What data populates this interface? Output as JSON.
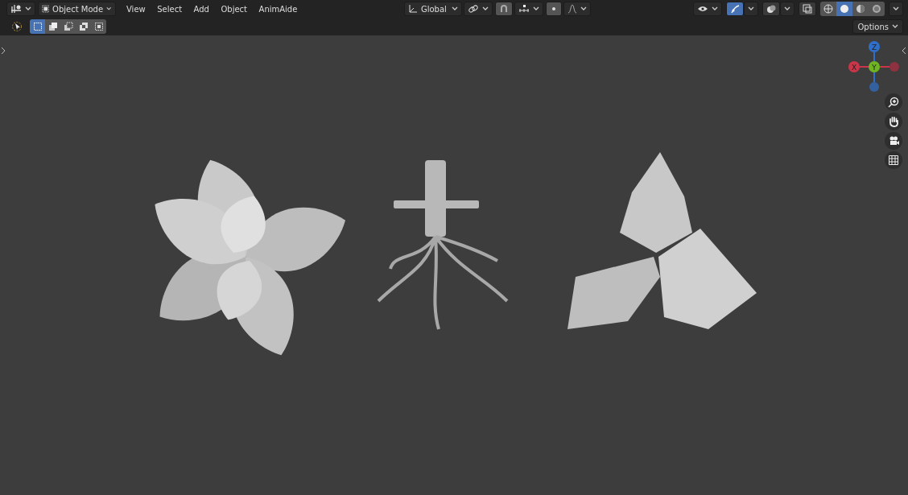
{
  "header": {
    "mode": {
      "value": "Object Mode"
    },
    "menus": [
      "View",
      "Select",
      "Add",
      "Object",
      "AnimAide"
    ],
    "orientation": {
      "value": "Global"
    },
    "viewport_toggles": [
      {
        "kind": "gizmos",
        "on": true
      },
      {
        "kind": "overlays",
        "on": false
      },
      {
        "kind": "xray",
        "on": false
      }
    ],
    "shading_modes": [
      {
        "kind": "wireframe",
        "selected": false
      },
      {
        "kind": "solid",
        "selected": true
      },
      {
        "kind": "material",
        "selected": false
      },
      {
        "kind": "rendered",
        "selected": false
      }
    ]
  },
  "toolbar": {
    "select_modes": [
      {
        "kind": "set",
        "selected": true
      },
      {
        "kind": "extend",
        "selected": false
      },
      {
        "kind": "subtract",
        "selected": false
      },
      {
        "kind": "invert",
        "selected": false
      },
      {
        "kind": "intersect",
        "selected": false
      }
    ],
    "options": {
      "label": "Options"
    }
  },
  "navigation_gizmo": {
    "axes": [
      {
        "label": "Z",
        "color": "#2f6fc9"
      },
      {
        "label": "X",
        "color": "#c9364a"
      },
      {
        "label": "Y",
        "color": "#6fb521"
      }
    ]
  }
}
